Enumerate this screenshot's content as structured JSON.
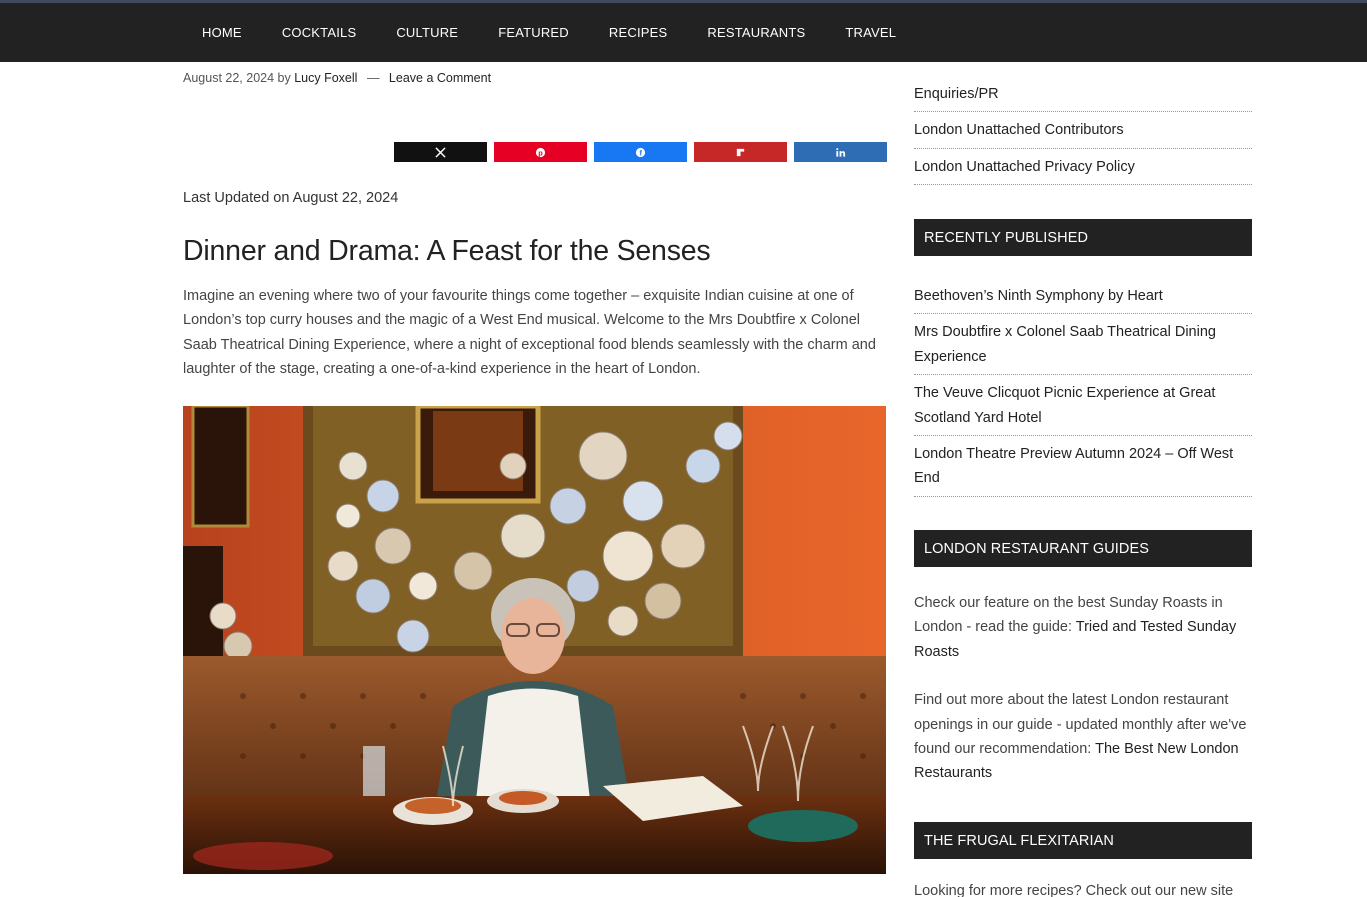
{
  "nav": {
    "items": [
      "HOME",
      "COCKTAILS",
      "CULTURE",
      "FEATURED",
      "RECIPES",
      "RESTAURANTS",
      "TRAVEL"
    ]
  },
  "article": {
    "date": "August 22, 2024",
    "by": "by",
    "author": "Lucy Foxell",
    "separator": "—",
    "comment_link": "Leave a Comment",
    "last_updated": "Last Updated on August 22, 2024",
    "title": "Dinner and Drama: A Feast for the Senses",
    "intro": "Imagine an evening where two of your favourite things come together – exquisite Indian cuisine at one of London’s top curry houses and the magic of a West End musical. Welcome to the Mrs Doubtfire x Colonel Saab Theatrical Dining Experience, where a night of exceptional food blends seamlessly with the charm and laughter of the stage, creating a one-of-a-kind experience in the heart of London.",
    "share_buttons": [
      {
        "network": "x",
        "icon": "x-logo-icon",
        "color": "#111111"
      },
      {
        "network": "pinterest",
        "icon": "pinterest-icon",
        "color": "#e60023"
      },
      {
        "network": "facebook",
        "icon": "facebook-icon",
        "color": "#1877f2"
      },
      {
        "network": "flipboard",
        "icon": "flipboard-icon",
        "color": "#c62828"
      },
      {
        "network": "linkedin",
        "icon": "linkedin-icon",
        "color": "#2e6db4"
      }
    ]
  },
  "sidebar": {
    "top_links": [
      "Enquiries/PR",
      "London Unattached Contributors",
      "London Unattached Privacy Policy"
    ],
    "recently_published": {
      "title": "RECENTLY PUBLISHED",
      "items": [
        "Beethoven’s Ninth Symphony by Heart",
        "Mrs Doubtfire x Colonel Saab Theatrical Dining Experience",
        "The Veuve Clicquot Picnic Experience at Great Scotland Yard Hotel",
        "London Theatre Preview Autumn 2024 – Off West End"
      ]
    },
    "restaurant_guides": {
      "title": "LONDON RESTAURANT GUIDES",
      "p1_text": "Check our feature on the best Sunday Roasts in London - read the guide: ",
      "p1_link": "Tried and Tested Sunday Roasts",
      "p2_text": "Find out more about the latest London restaurant openings in our guide - updated monthly after we've found our recommendation: ",
      "p2_link": "The Best New London Restaurants"
    },
    "frugal": {
      "title": "THE FRUGAL FLEXITARIAN",
      "text": "Looking for more recipes? Check out our new site"
    }
  }
}
